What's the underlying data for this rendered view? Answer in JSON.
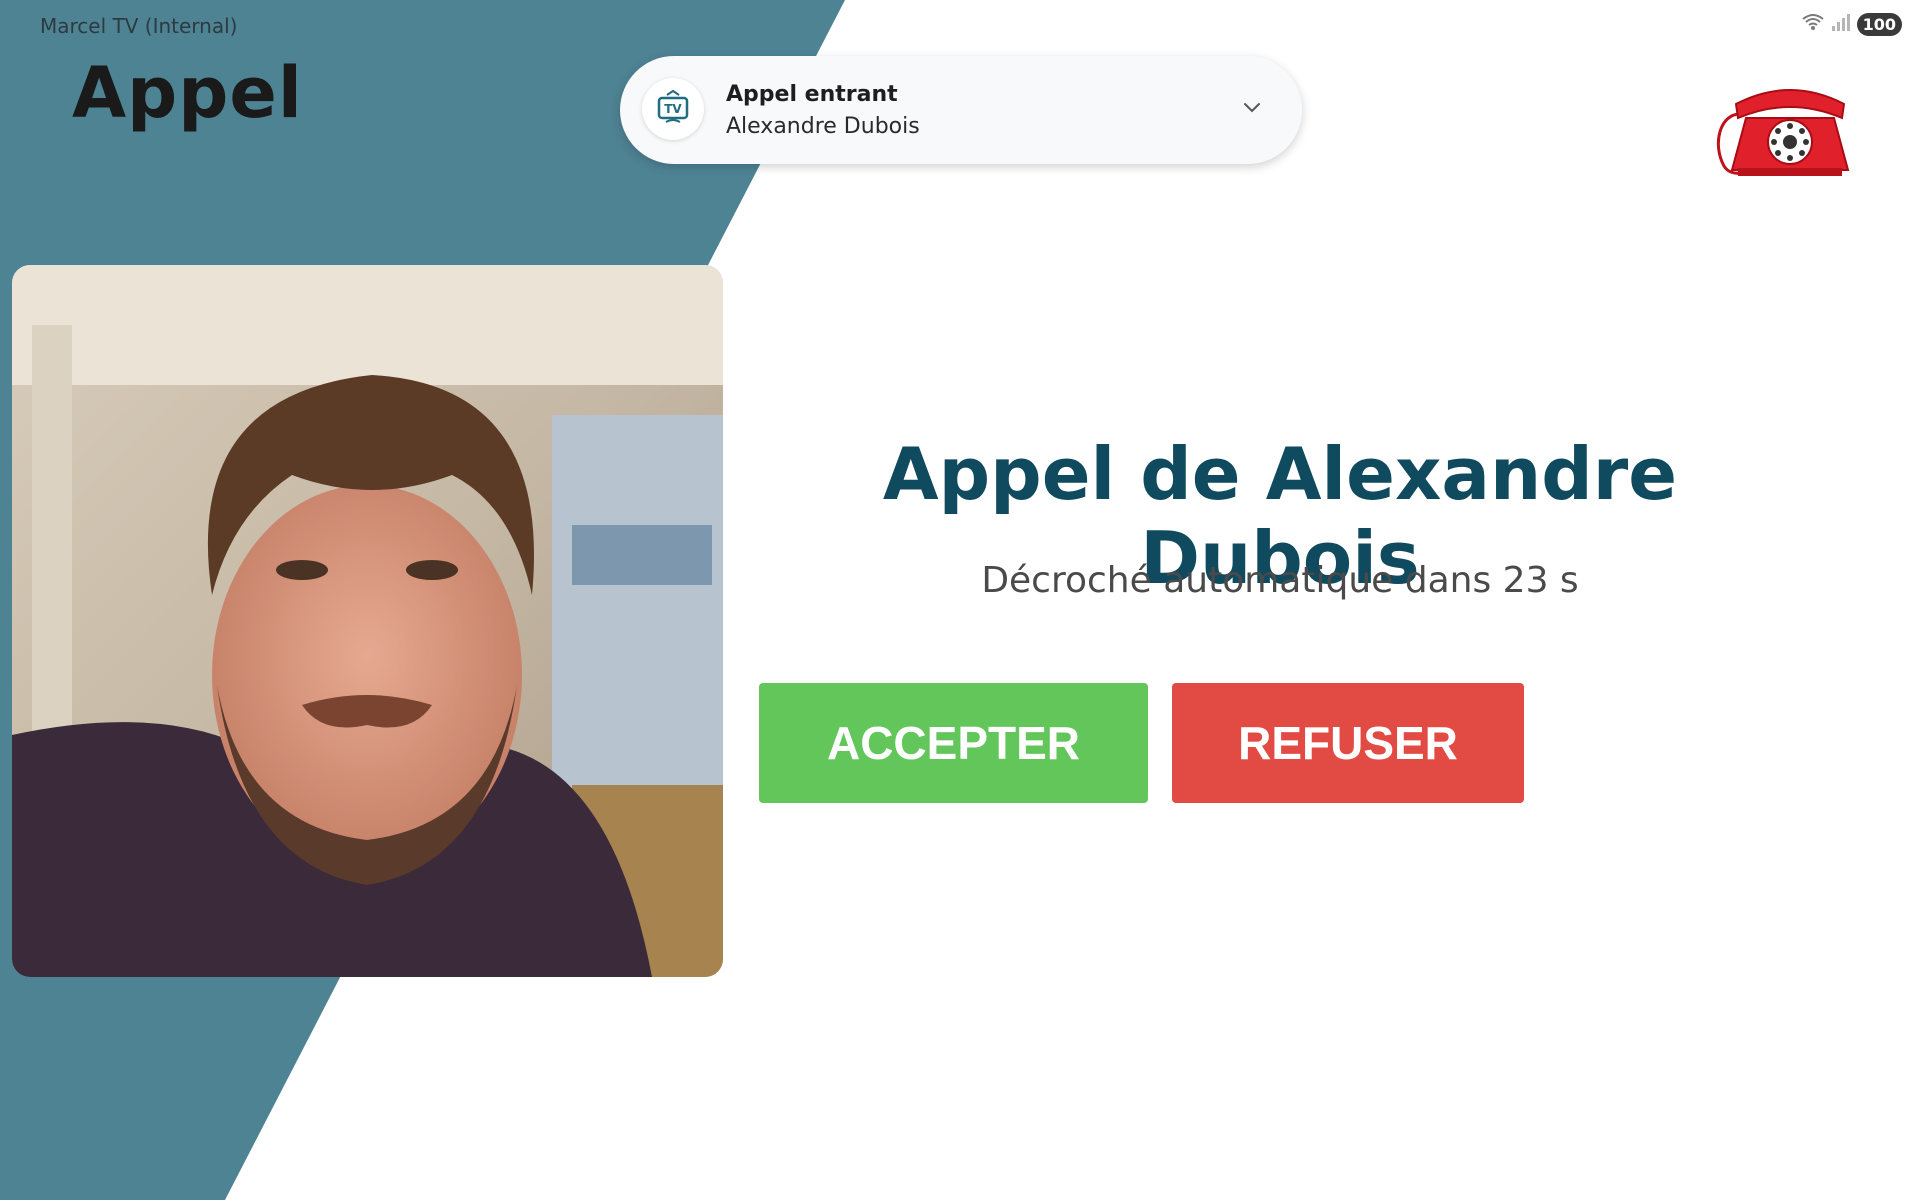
{
  "status_bar": {
    "app_label": "Marcel TV (Internal)",
    "battery": "100",
    "icons": [
      "wifi-icon",
      "signal-icon",
      "battery-icon"
    ]
  },
  "page": {
    "title": "Appel"
  },
  "notification": {
    "icon": "tv-icon",
    "title": "Appel entrant",
    "subtitle": "Alexandre Dubois",
    "expand_icon": "chevron-down-icon"
  },
  "caller": {
    "photo": "caller-photo",
    "heading": "Appel de Alexandre Dubois",
    "auto_answer": "Décroché automatique dans 23 s"
  },
  "actions": {
    "accept_label": "ACCEPTER",
    "refuse_label": "REFUSER"
  },
  "colors": {
    "panel_teal": "#4e8394",
    "heading_blue": "#0f4a5e",
    "accept_green": "#62c65a",
    "refuse_red": "#e24b43",
    "phone_red": "#e0202a"
  }
}
